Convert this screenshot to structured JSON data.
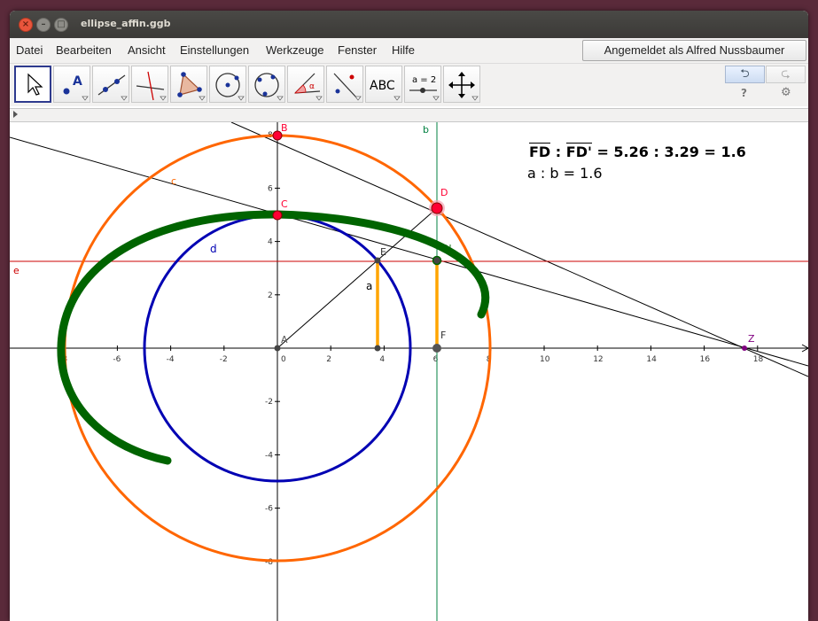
{
  "window": {
    "title": "ellipse_affin.ggb",
    "controls": {
      "close": "×",
      "minimize": "–",
      "maximize": "□"
    }
  },
  "menu": {
    "items": [
      "Datei",
      "Bearbeiten",
      "Ansicht",
      "Einstellungen",
      "Werkzeuge",
      "Fenster",
      "Hilfe"
    ],
    "login": "Angemeldet als Alfred Nussbaumer"
  },
  "toolbar": {
    "tools": [
      "move-tool",
      "point-tool",
      "line-tool",
      "perpendicular-tool",
      "polygon-tool",
      "circle-tool",
      "conic-tool",
      "angle-tool",
      "reflect-tool",
      "text-tool",
      "slider-tool",
      "move-view-tool"
    ],
    "text_tool_label": "ABC",
    "slider_tool_label": "a = 2",
    "undo": "⮌",
    "redo": "⮎",
    "help": "?",
    "settings": "⚙"
  },
  "graphics": {
    "equation_ratio": {
      "left": "FD",
      "sep": " : ",
      "right": "FD'",
      "values": " = 5.26 : 3.29 = 1.6"
    },
    "equation_ab": "a : b = 1.6",
    "x_ticks": [
      "-8",
      "-6",
      "-4",
      "-2",
      "0",
      "2",
      "4",
      "6",
      "8",
      "10",
      "12",
      "14",
      "16",
      "18"
    ],
    "y_ticks": [
      "-8",
      "-6",
      "-4",
      "-2",
      "0",
      "2",
      "4",
      "6",
      "8"
    ],
    "labels": {
      "A": "A",
      "B": "B",
      "C": "C",
      "D": "D",
      "Dp": "D'",
      "E": "E",
      "F": "F",
      "Z": "Z",
      "a": "a",
      "b": "b",
      "c": "c",
      "d": "d",
      "e": "e"
    },
    "colors": {
      "orange_circle": "#ff6600",
      "blue_circle": "#0000b3",
      "ellipse": "#006400",
      "points_red": "#ff0033",
      "segment_orange": "#ffa500",
      "line_b": "#008040",
      "line_e": "#cc0000",
      "point_Z": "#800080"
    }
  }
}
